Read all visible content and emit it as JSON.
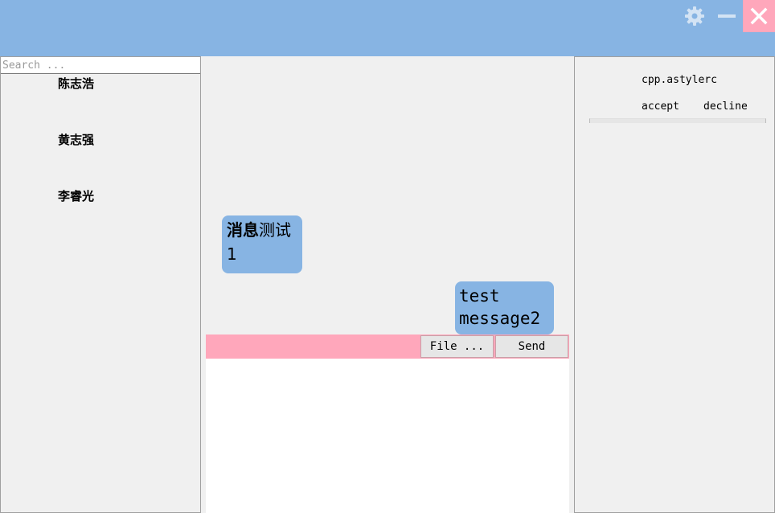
{
  "window": {
    "colors": {
      "titlebar": "#87b4e3",
      "close_bg": "#ffa7bb",
      "bubble": "#87b4e3",
      "toolbar": "#ffa7bb"
    },
    "icons": {
      "settings": "gear-icon",
      "minimize": "minimize-icon",
      "close": "close-icon"
    }
  },
  "sidebar": {
    "search_placeholder": "Search ...",
    "contacts": [
      {
        "name": "陈志浩"
      },
      {
        "name": "黄志强"
      },
      {
        "name": "李睿光"
      }
    ]
  },
  "chat": {
    "messages": [
      {
        "direction": "incoming",
        "bold_text": "消息",
        "text": "测试1"
      },
      {
        "direction": "outgoing",
        "text": "test message2"
      }
    ]
  },
  "composer": {
    "file_label": "File ...",
    "send_label": "Send",
    "input_value": ""
  },
  "transfer": {
    "file_name": "cpp.astylerc",
    "accept_label": "accept",
    "decline_label": "decline",
    "progress": 0
  }
}
